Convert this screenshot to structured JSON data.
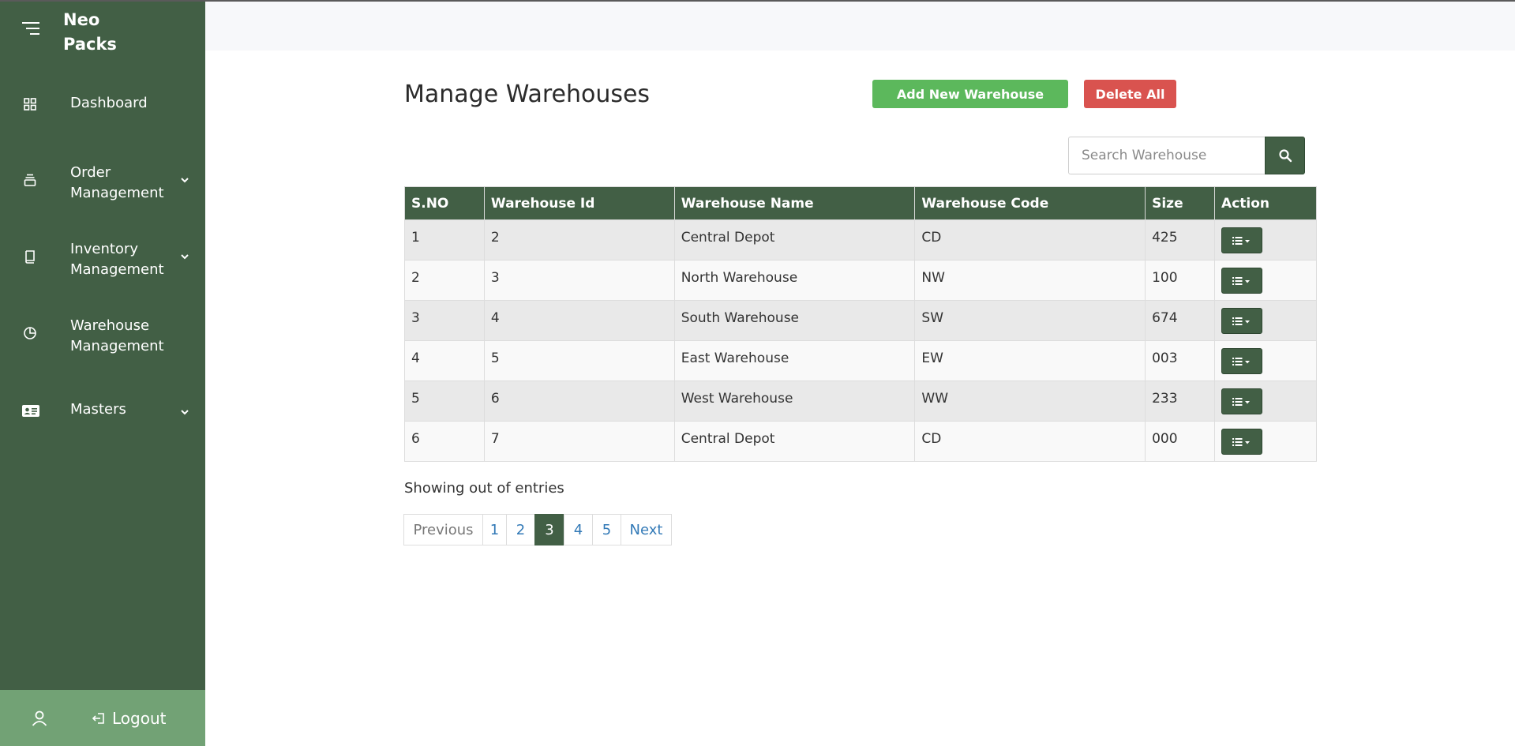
{
  "brand": {
    "line1": "Neo",
    "line2": "Packs"
  },
  "sidebar": {
    "items": [
      {
        "line1": "Dashboard",
        "line2": "",
        "icon": "grid-icon",
        "has_chevron": false
      },
      {
        "line1": "Order",
        "line2": "Management",
        "icon": "stack-icon",
        "has_chevron": true
      },
      {
        "line1": "Inventory",
        "line2": "Management",
        "icon": "book-icon",
        "has_chevron": true
      },
      {
        "line1": "Warehouse",
        "line2": "Management",
        "icon": "pie-chart-icon",
        "has_chevron": false
      },
      {
        "line1": "Masters",
        "line2": "",
        "icon": "id-card-icon",
        "has_chevron": true
      }
    ],
    "logout_label": "Logout"
  },
  "page": {
    "title": "Manage Warehouses",
    "add_button": "Add New Warehouse",
    "delete_all_button": "Delete All",
    "search_placeholder": "Search Warehouse"
  },
  "table": {
    "headers": [
      "S.NO",
      "Warehouse Id",
      "Warehouse Name",
      "Warehouse Code",
      "Size",
      "Action"
    ],
    "rows": [
      [
        "1",
        "2",
        "Central Depot",
        "CD",
        "425"
      ],
      [
        "2",
        "3",
        "North Warehouse",
        "NW",
        "100"
      ],
      [
        "3",
        "4",
        "South Warehouse",
        "SW",
        "674"
      ],
      [
        "4",
        "5",
        "East Warehouse",
        "EW",
        "003"
      ],
      [
        "5",
        "6",
        "West Warehouse",
        "WW",
        "233"
      ],
      [
        "6",
        "7",
        "Central Depot",
        "CD",
        "000"
      ]
    ]
  },
  "info": "Showing out of entries",
  "pagination": {
    "previous": "Previous",
    "pages": [
      "1",
      "2",
      "3",
      "4",
      "5"
    ],
    "active_page": "3",
    "next": "Next"
  },
  "colors": {
    "sidebar": "#425f45",
    "logout_bar": "#72a275",
    "add": "#5cb85c",
    "delete": "#d9534f",
    "link": "#337ab7"
  }
}
